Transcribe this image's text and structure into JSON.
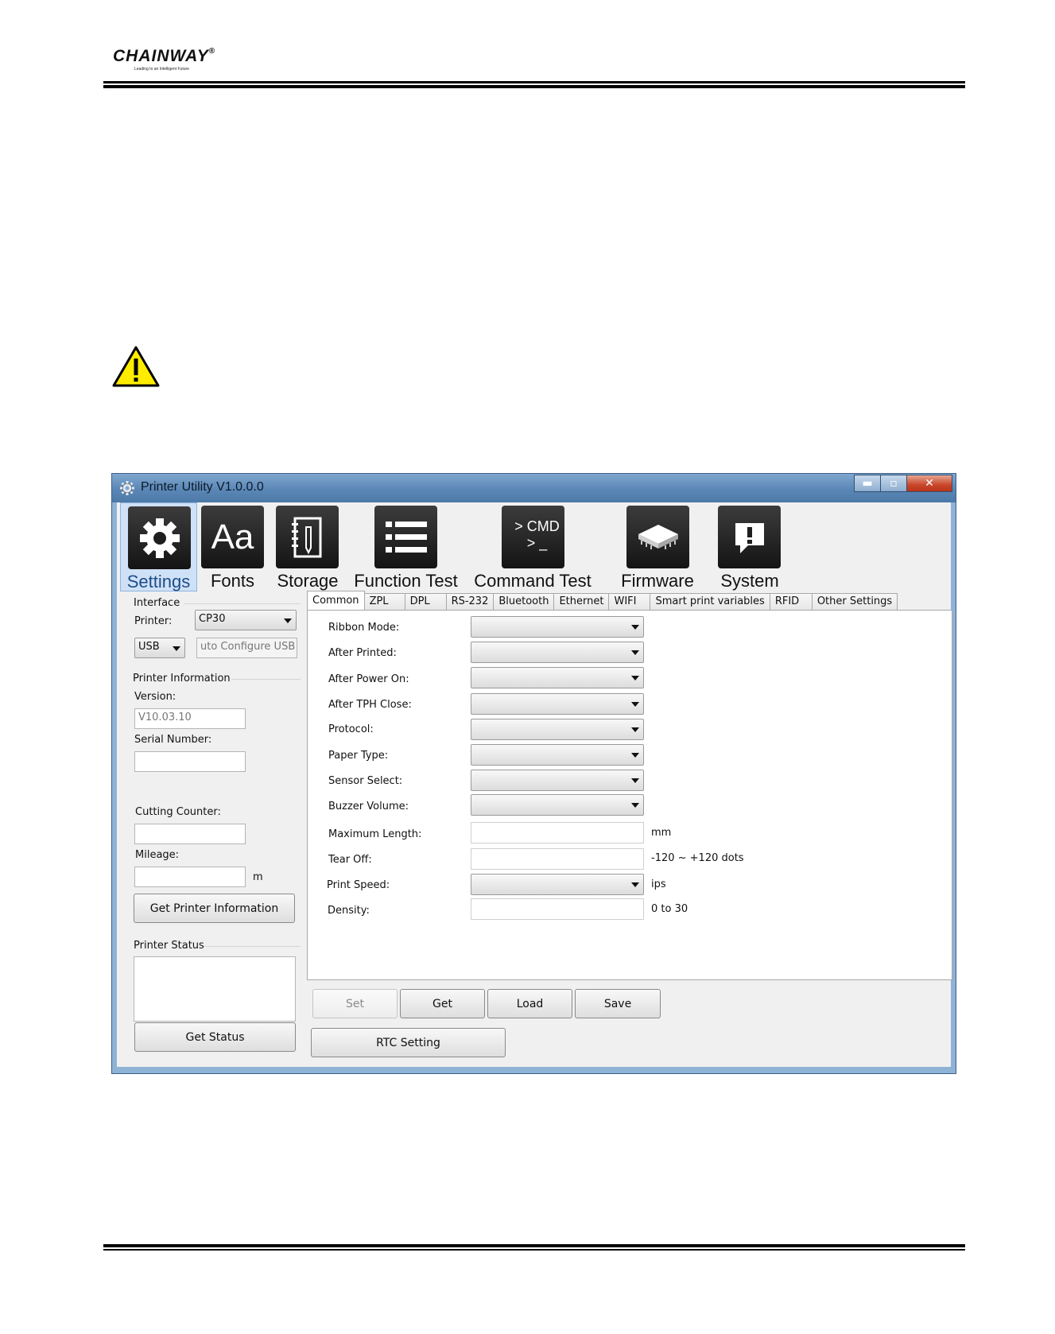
{
  "header": {
    "logo_text": "CHAINWAY",
    "logo_mark": "®",
    "logo_tagline": "Leading to an Intelligent Future"
  },
  "window": {
    "title": "Printer Utility  V1.0.0.0",
    "controls": {
      "minimize": "▬",
      "maximize": "▫",
      "close": "✕"
    }
  },
  "toolbar": [
    {
      "label": "Settings",
      "icon": "gear-icon",
      "active": true
    },
    {
      "label": "Fonts",
      "icon": "fonts-icon",
      "icon_text": "Aa"
    },
    {
      "label": "Storage",
      "icon": "notebook-icon"
    },
    {
      "label": "Function Test",
      "icon": "list-icon"
    },
    {
      "label": "Command Test",
      "icon": "cmd-icon",
      "icon_text": "> CMD\n> _"
    },
    {
      "label": "Firmware",
      "icon": "chip-icon"
    },
    {
      "label": "System",
      "icon": "alert-bubble-icon"
    }
  ],
  "left_panel": {
    "interface_title": "Interface",
    "printer_label": "Printer:",
    "printer_value": "CP30",
    "port_value": "USB",
    "auto_config_value": "uto Configure USB Pc",
    "info_title": "Printer Information",
    "version_label": "Version:",
    "version_value": "V10.03.10",
    "serial_label": "Serial Number:",
    "cutting_label": "Cutting Counter:",
    "mileage_label": "Mileage:",
    "mileage_unit": "m",
    "get_info_button": "Get Printer Information",
    "status_title": "Printer Status",
    "get_status_button": "Get Status"
  },
  "tabs": [
    "Common",
    "ZPL",
    "DPL",
    "RS-232",
    "Bluetooth",
    "Ethernet",
    "WIFI",
    "Smart print variables",
    "RFID",
    "Other Settings"
  ],
  "active_tab": "Common",
  "form": {
    "ribbon_mode": "Ribbon Mode:",
    "after_printed": "After Printed:",
    "after_power_on": "After Power On:",
    "after_tph_close": "After TPH Close:",
    "protocol": "Protocol:",
    "paper_type": "Paper Type:",
    "sensor_select": "Sensor Select:",
    "buzzer_volume": "Buzzer Volume:",
    "maximum_length": "Maximum Length:",
    "maximum_length_unit": "mm",
    "tear_off": "Tear Off:",
    "tear_off_unit": "-120 ~ +120 dots",
    "print_speed": "Print Speed:",
    "print_speed_unit": "ips",
    "density": "Density:",
    "density_unit": "0 to 30"
  },
  "actions": {
    "set": "Set",
    "get": "Get",
    "load": "Load",
    "save": "Save",
    "rtc": "RTC Setting"
  }
}
